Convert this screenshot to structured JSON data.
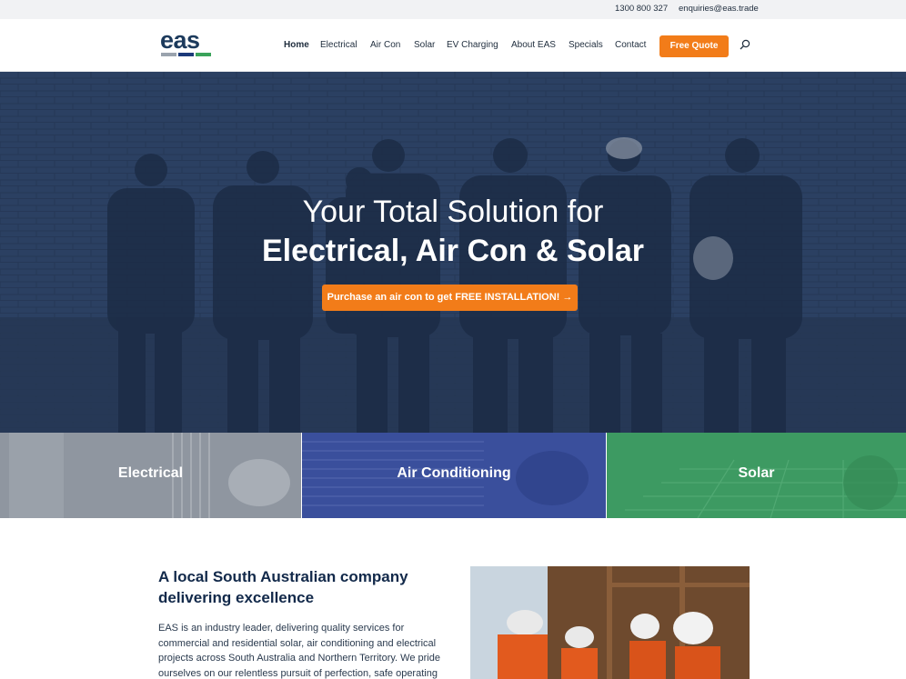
{
  "topbar": {
    "phone": "1300 800 327",
    "email": "enquiries@eas.trade"
  },
  "logo": {
    "text": "eas",
    "bar_colors": [
      "#9aa3ad",
      "#1c3a7a",
      "#3aa35a"
    ]
  },
  "nav": {
    "items": [
      "Home",
      "Electrical",
      "Air Con",
      "Solar",
      "EV Charging",
      "About EAS",
      "Specials",
      "Contact"
    ],
    "active": "Home",
    "cta": "Free Quote"
  },
  "hero": {
    "line1": "Your Total Solution for",
    "line2": "Electrical, Air Con & Solar",
    "cta": "Purchase an air con to get FREE INSTALLATION! →"
  },
  "tiles": [
    {
      "label": "Electrical",
      "color": "#8f96a0"
    },
    {
      "label": "Air Conditioning",
      "color": "#3a4f9c"
    },
    {
      "label": "Solar",
      "color": "#3d9a62"
    }
  ],
  "intro": {
    "title": "A local South Australian company delivering excellence",
    "body": "EAS is an industry leader, delivering quality services for commercial and residential solar, air conditioning and electrical projects across South Australia and Northern Territory. We pride ourselves on our relentless pursuit of perfection, safe operating"
  },
  "colors": {
    "accent": "#f27c19",
    "navy": "#12294a"
  }
}
